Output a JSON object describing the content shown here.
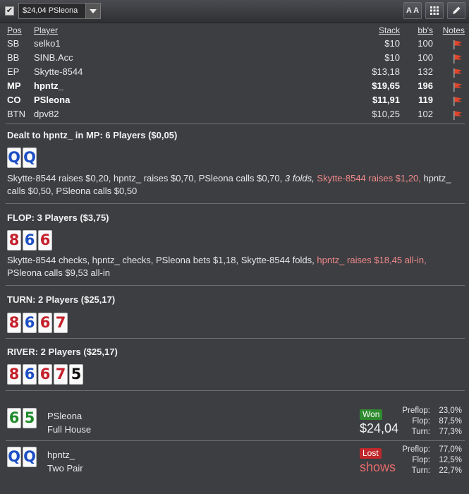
{
  "toolbar": {
    "checkbox_checked": true,
    "hand_selector_value": "$24,04 PSleona",
    "font_size_button": "A A",
    "grid_icon": "grid-icon",
    "edit_icon": "pencil-icon"
  },
  "players_table": {
    "headers": {
      "pos": "Pos",
      "player": "Player",
      "stack": "Stack",
      "bbs": "bb's",
      "notes": "Notes"
    },
    "rows": [
      {
        "pos": "SB",
        "player": "selko1",
        "stack": "$10",
        "bbs": "100",
        "bold": false
      },
      {
        "pos": "BB",
        "player": "SINB.Acc",
        "stack": "$10",
        "bbs": "100",
        "bold": false
      },
      {
        "pos": "EP",
        "player": "Skytte-8544",
        "stack": "$13,18",
        "bbs": "132",
        "bold": false
      },
      {
        "pos": "MP",
        "player": "hpntz_",
        "stack": "$19,65",
        "bbs": "196",
        "bold": true
      },
      {
        "pos": "CO",
        "player": "PSleona",
        "stack": "$11,91",
        "bbs": "119",
        "bold": true
      },
      {
        "pos": "BTN",
        "player": "dpv82",
        "stack": "$10,25",
        "bbs": "102",
        "bold": false
      }
    ]
  },
  "preflop": {
    "title": "Dealt to hpntz_ in MP: 6 Players ($0,05)",
    "cards": [
      {
        "rank": "Q",
        "suit": "d"
      },
      {
        "rank": "Q",
        "suit": "d"
      }
    ],
    "actions": [
      {
        "t": "Skytte-8544 raises $0,20, hpntz_ raises $0,70, PSleona calls $0,70, ",
        "style": "normal"
      },
      {
        "t": "3 folds,",
        "style": "italic"
      },
      {
        "t": " ",
        "style": "normal"
      },
      {
        "t": "Skytte-8544 raises $1,20,",
        "style": "hl"
      },
      {
        "t": " hpntz_ calls $0,50, PSleona calls $0,50",
        "style": "normal"
      }
    ]
  },
  "flop": {
    "title": "FLOP: 3 Players ($3,75)",
    "cards": [
      {
        "rank": "8",
        "suit": "h"
      },
      {
        "rank": "6",
        "suit": "d"
      },
      {
        "rank": "6",
        "suit": "h"
      }
    ],
    "actions": [
      {
        "t": "Skytte-8544 checks, hpntz_ checks, PSleona bets $1,18, Skytte-8544 folds, ",
        "style": "normal"
      },
      {
        "t": "hpntz_ raises $18,45 all-in,",
        "style": "hl"
      },
      {
        "t": " PSleona calls $9,53 all-in",
        "style": "normal"
      }
    ]
  },
  "turn": {
    "title": "TURN: 2 Players ($25,17)",
    "cards": [
      {
        "rank": "8",
        "suit": "h"
      },
      {
        "rank": "6",
        "suit": "d"
      },
      {
        "rank": "6",
        "suit": "h"
      },
      {
        "rank": "7",
        "suit": "h"
      }
    ]
  },
  "river": {
    "title": "RIVER: 2 Players ($25,17)",
    "cards": [
      {
        "rank": "8",
        "suit": "h"
      },
      {
        "rank": "6",
        "suit": "d"
      },
      {
        "rank": "6",
        "suit": "h"
      },
      {
        "rank": "7",
        "suit": "h"
      },
      {
        "rank": "5",
        "suit": "s"
      }
    ]
  },
  "results": [
    {
      "cards": [
        {
          "rank": "6",
          "suit": "c"
        },
        {
          "rank": "5",
          "suit": "c"
        }
      ],
      "player": "PSleona",
      "hand": "Full House",
      "badge": "Won",
      "badge_color": "#2e8b2e",
      "amount": "$24,04",
      "amount_color": "#f2f2f2",
      "stats": [
        {
          "k": "Preflop:",
          "v": "23,0%"
        },
        {
          "k": "Flop:",
          "v": "87,5%"
        },
        {
          "k": "Turn:",
          "v": "77,3%"
        }
      ]
    },
    {
      "cards": [
        {
          "rank": "Q",
          "suit": "d"
        },
        {
          "rank": "Q",
          "suit": "d"
        }
      ],
      "player": "hpntz_",
      "hand": "Two Pair",
      "badge": "Lost",
      "badge_color": "#c0282b",
      "amount": "shows",
      "amount_color": "#e46a6a",
      "stats": [
        {
          "k": "Preflop:",
          "v": "77,0%"
        },
        {
          "k": "Flop:",
          "v": "12,5%"
        },
        {
          "k": "Turn:",
          "v": "22,7%"
        }
      ]
    }
  ]
}
